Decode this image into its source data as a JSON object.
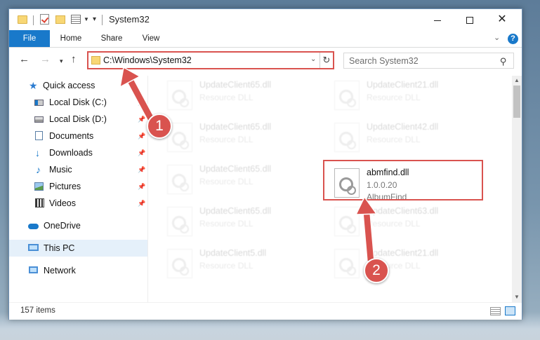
{
  "window": {
    "title": "System32",
    "controls": {
      "minimize": "minimize",
      "maximize": "maximize",
      "close": "✕"
    }
  },
  "ribbon": {
    "tabs": [
      {
        "label": "File",
        "active": true
      },
      {
        "label": "Home"
      },
      {
        "label": "Share"
      },
      {
        "label": "View"
      }
    ],
    "help": "?"
  },
  "address": {
    "path": "C:\\Windows\\System32",
    "refresh_glyph": "↻"
  },
  "search": {
    "placeholder": "Search System32"
  },
  "nav": {
    "items": [
      {
        "label": "Quick access",
        "icon": "star-icon"
      },
      {
        "label": "Local Disk (C:)",
        "icon": "drive-icon",
        "pinned": true
      },
      {
        "label": "Local Disk (D:)",
        "icon": "drive-icon",
        "pinned": true
      },
      {
        "label": "Documents",
        "icon": "documents-icon",
        "pinned": true
      },
      {
        "label": "Downloads",
        "icon": "downloads-icon",
        "pinned": true
      },
      {
        "label": "Music",
        "icon": "music-icon",
        "pinned": true
      },
      {
        "label": "Pictures",
        "icon": "pictures-icon",
        "pinned": true
      },
      {
        "label": "Videos",
        "icon": "videos-icon",
        "pinned": true
      },
      {
        "label": "OneDrive",
        "icon": "onedrive-icon"
      },
      {
        "label": "This PC",
        "icon": "pc-icon",
        "selected": true
      },
      {
        "label": "Network",
        "icon": "network-icon"
      }
    ]
  },
  "files": {
    "left": [
      {
        "name": "UpdateClient65.dll",
        "type": "Resource DLL"
      },
      {
        "name": "UpdateClient65.dll",
        "type": "Resource DLL"
      },
      {
        "name": "UpdateClient65.dll",
        "type": "Resource DLL"
      },
      {
        "name": "UpdateClient65.dll",
        "type": "Resource DLL"
      },
      {
        "name": "UpdateClient5.dll",
        "type": "Resource DLL"
      }
    ],
    "right": [
      {
        "name": "UpdateClient21.dll",
        "type": "Resource DLL"
      },
      {
        "name": "UpdateClient42.dll",
        "type": "Resource DLL"
      },
      {
        "name": "UpdateClient63.dll",
        "type": "Resource DLL"
      },
      {
        "name": "UpdateClient21.dll",
        "type": "Resource DLL"
      }
    ],
    "highlighted": {
      "name": "abmfind.dll",
      "version": "1.0.0.20",
      "description": "AlbumFind"
    }
  },
  "status": {
    "item_count": "157 items"
  },
  "annotations": {
    "step1": "1",
    "step2": "2",
    "color": "#d9534f"
  }
}
